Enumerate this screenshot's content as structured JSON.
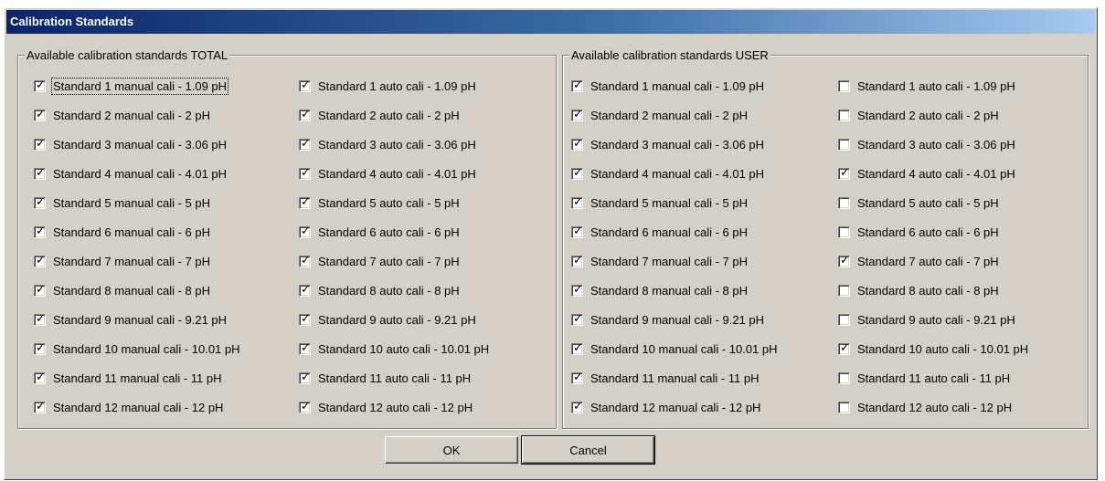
{
  "window": {
    "title": "Calibration Standards"
  },
  "groups": {
    "total": {
      "legend": "Available calibration standards TOTAL",
      "manual": [
        {
          "label": "Standard 1 manual cali - 1.09 pH",
          "checked": true
        },
        {
          "label": "Standard 2 manual cali - 2 pH",
          "checked": true
        },
        {
          "label": "Standard 3 manual cali - 3.06 pH",
          "checked": true
        },
        {
          "label": "Standard 4 manual cali - 4.01 pH",
          "checked": true
        },
        {
          "label": "Standard 5 manual cali - 5 pH",
          "checked": true
        },
        {
          "label": "Standard 6 manual cali - 6 pH",
          "checked": true
        },
        {
          "label": "Standard 7 manual cali - 7 pH",
          "checked": true
        },
        {
          "label": "Standard 8 manual cali - 8 pH",
          "checked": true
        },
        {
          "label": "Standard 9 manual cali - 9.21 pH",
          "checked": true
        },
        {
          "label": "Standard 10 manual cali - 10.01 pH",
          "checked": true
        },
        {
          "label": "Standard 11 manual cali - 11 pH",
          "checked": true
        },
        {
          "label": "Standard 12 manual cali - 12 pH",
          "checked": true
        }
      ],
      "auto": [
        {
          "label": "Standard 1 auto cali - 1.09 pH",
          "checked": true
        },
        {
          "label": "Standard 2 auto cali - 2 pH",
          "checked": true
        },
        {
          "label": "Standard 3 auto cali - 3.06 pH",
          "checked": true
        },
        {
          "label": "Standard 4 auto cali - 4.01 pH",
          "checked": true
        },
        {
          "label": "Standard 5 auto cali - 5 pH",
          "checked": true
        },
        {
          "label": "Standard 6 auto cali - 6 pH",
          "checked": true
        },
        {
          "label": "Standard 7 auto cali - 7 pH",
          "checked": true
        },
        {
          "label": "Standard 8 auto cali - 8 pH",
          "checked": true
        },
        {
          "label": "Standard 9 auto cali - 9.21 pH",
          "checked": true
        },
        {
          "label": "Standard 10 auto cali - 10.01 pH",
          "checked": true
        },
        {
          "label": "Standard 11 auto cali - 11 pH",
          "checked": true
        },
        {
          "label": "Standard 12 auto cali - 12 pH",
          "checked": true
        }
      ]
    },
    "user": {
      "legend": "Available calibration standards USER",
      "manual": [
        {
          "label": "Standard 1 manual cali - 1.09 pH",
          "checked": true
        },
        {
          "label": "Standard 2 manual cali - 2 pH",
          "checked": true
        },
        {
          "label": "Standard 3 manual cali - 3.06 pH",
          "checked": true
        },
        {
          "label": "Standard 4 manual cali - 4.01 pH",
          "checked": true
        },
        {
          "label": "Standard 5 manual cali - 5 pH",
          "checked": true
        },
        {
          "label": "Standard 6 manual cali - 6 pH",
          "checked": true
        },
        {
          "label": "Standard 7 manual cali - 7 pH",
          "checked": true
        },
        {
          "label": "Standard 8 manual cali - 8 pH",
          "checked": true
        },
        {
          "label": "Standard 9 manual cali - 9.21 pH",
          "checked": true
        },
        {
          "label": "Standard 10 manual cali - 10.01 pH",
          "checked": true
        },
        {
          "label": "Standard 11 manual cali - 11 pH",
          "checked": true
        },
        {
          "label": "Standard 12 manual cali - 12 pH",
          "checked": true
        }
      ],
      "auto": [
        {
          "label": "Standard 1 auto cali - 1.09 pH",
          "checked": false
        },
        {
          "label": "Standard 2 auto cali - 2 pH",
          "checked": false
        },
        {
          "label": "Standard 3 auto cali - 3.06 pH",
          "checked": false
        },
        {
          "label": "Standard 4 auto cali - 4.01 pH",
          "checked": true
        },
        {
          "label": "Standard 5 auto cali - 5 pH",
          "checked": false
        },
        {
          "label": "Standard 6 auto cali - 6 pH",
          "checked": false
        },
        {
          "label": "Standard 7 auto cali - 7 pH",
          "checked": true
        },
        {
          "label": "Standard 8 auto cali - 8 pH",
          "checked": false
        },
        {
          "label": "Standard 9 auto cali - 9.21 pH",
          "checked": false
        },
        {
          "label": "Standard 10 auto cali - 10.01 pH",
          "checked": true
        },
        {
          "label": "Standard 11 auto cali - 11 pH",
          "checked": false
        },
        {
          "label": "Standard 12 auto cali - 12 pH",
          "checked": false
        }
      ]
    }
  },
  "buttons": {
    "ok": "OK",
    "cancel": "Cancel"
  },
  "icons": {
    "check": "checkmark-icon"
  },
  "colors": {
    "dialog_bg": "#d4d0c8",
    "title_start": "#0a246a",
    "title_end": "#a6caf0",
    "title_text": "#ffffff"
  }
}
